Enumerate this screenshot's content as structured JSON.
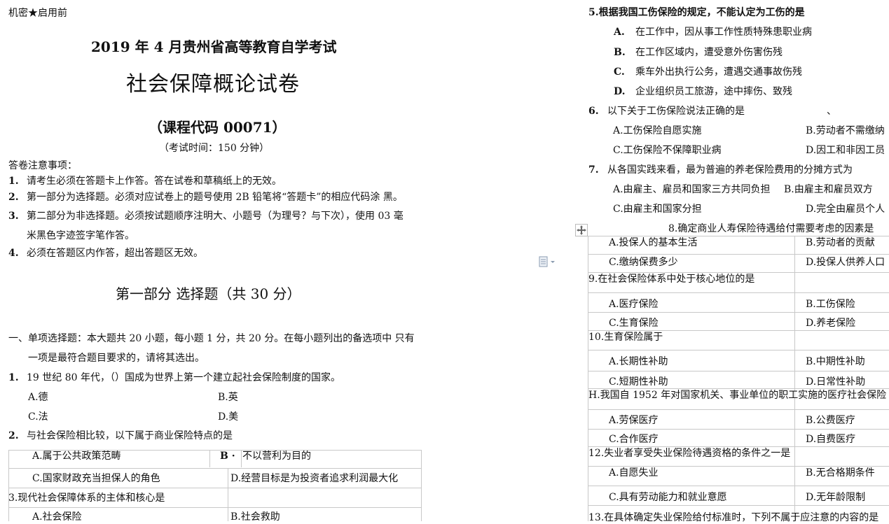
{
  "left": {
    "secret": "机密★启用前",
    "exam_line": "2019 年 4 月贵州省高等教育自学考试",
    "title": "社会保障概论试卷",
    "course_code": "（课程代码  00071）",
    "time": "（考试时间：150 分钟）",
    "notes_heading": "答卷注意事项：",
    "notes": [
      {
        "num": "1.",
        "text": "请考生必须在答题卡上作答。答在试卷和草稿纸上的无效。"
      },
      {
        "num": "2.",
        "text": "第一部分为选择题。必须对应试卷上的题号使用 2B 铅笔将“答题卡”的相应代码涂 黑。"
      },
      {
        "num": "3.",
        "text": "第二部分为非选择题。必须按试题顺序注明大、小题号（为理号？与下次），使用 03 毫"
      },
      {
        "num": "",
        "text": "米黑色字迹签字笔作答。"
      },
      {
        "num": "4.",
        "text": "必须在答题区内作答，超出答题区无效。"
      }
    ],
    "part1": "第一部分  选择题（共 30 分）",
    "section1_line1": "一、单项选择题：本大题共 20 小题，每小题 1 分，共 20 分。在每小题列出的备选项中 只有",
    "section1_line2": "一项是最符合题目要求的，请将其选出。",
    "q1": {
      "num": "1.",
      "text": "19 世纪 80 年代，（）国成为世界上第一个建立起社会保险制度的国家。",
      "a": "A.德",
      "b": "B.英",
      "c": "C.法",
      "d": "D.美"
    },
    "q2": {
      "num": "2.",
      "text": "与社会保险相比较，以下属于商业保险特点的是",
      "a": "A.属于公共政策范畴",
      "b_letter": "B ·",
      "b": "不以营利为目的",
      "c": "C.国家财政充当担保人的角色",
      "d": "D.经营目标是为投资者追求利润最大化"
    },
    "q3": {
      "text": "3.现代社会保障体系的主体和核心是",
      "a": "A.社会保险",
      "b": "B.社会救助"
    }
  },
  "right": {
    "q5": {
      "text": "5.根据我国工伤保险的规定，不能认定为工伤的是",
      "options": [
        {
          "letter": "A.",
          "text": "在工作中，因从事工作性质特殊患职业病"
        },
        {
          "letter": "B.",
          "text": "在工作区域内，遭受意外伤害伤残"
        },
        {
          "letter": "C.",
          "text": "乘车外出执行公务，遭遇交通事故伤残"
        },
        {
          "letter": "D.",
          "text": "企业组织员工旅游，途中摔伤、致残"
        }
      ]
    },
    "q6": {
      "num": "6.",
      "text": "以下关于工伤保险说法正确的是",
      "mark": "、",
      "a": "A.工伤保险自愿实施",
      "b": "B.劳动者不需缴纳",
      "c": "C.工伤保险不保障职业病",
      "d": "D.因工和非因工员"
    },
    "q7": {
      "num": "7.",
      "text": "从各国实践来看，最为普遍的养老保险费用的分摊方式为",
      "a": "A.由雇主、雇员和国家三方共同负担",
      "b": "B.由雇主和雇员双方",
      "c": "C.由雇主和国家分担",
      "d": "D.完全由雇员个人"
    },
    "q8": {
      "text": "8.确定商业人寿保险待遇给付需要考虑的因素是",
      "a": "A.投保人的基本生活",
      "b": "B.劳动者的贡献",
      "c": "C.缴纳保费多少",
      "d": "D.投保人供养人口"
    },
    "q9": {
      "text": "9.在社会保险体系中处于核心地位的是",
      "a": "A.医疗保险",
      "b": "B.工伤保险",
      "c": "C.生育保险",
      "d": "D.养老保险"
    },
    "q10": {
      "text": "10.生育保险属于",
      "a": "A.长期性补助",
      "b": "B.中期性补助",
      "c": "C.短期性补助",
      "d": "D.日常性补助"
    },
    "q11": {
      "text": "H.我国自 1952 年对国家机关、事业单位的职工实施的医疗社会保险",
      "a": "A.劳保医疗",
      "b": "B.公费医疗",
      "c": "C.合作医疗",
      "d": "D.自费医疗"
    },
    "q12": {
      "text": "12.失业者享受失业保险待遇资格的条件之一是",
      "a": "A.自愿失业",
      "b": "B.无合格期条件",
      "c": "C.具有劳动能力和就业意愿",
      "d": "D.无年龄限制"
    },
    "q13": {
      "text": "13.在具体确定失业保险给付标准时，下列不属于应注意的内容的是"
    }
  }
}
